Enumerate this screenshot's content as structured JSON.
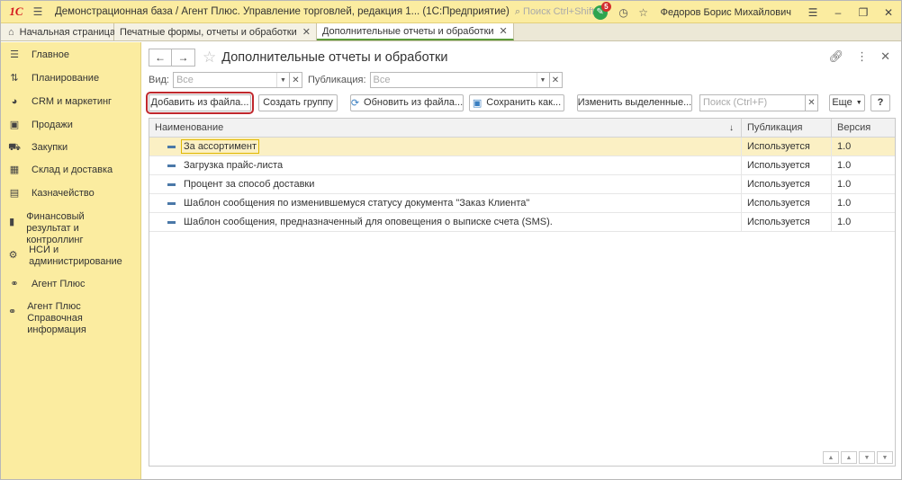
{
  "titlebar": {
    "logo": "1С",
    "title": "Демонстрационная база / Агент Плюс. Управление торговлей, редакция 1...  (1С:Предприятие)",
    "search_placeholder": "Поиск Ctrl+Shift+F",
    "notifications_count": "5",
    "user": "Федоров Борис Михайлович"
  },
  "tabs": {
    "home": "Начальная страница",
    "items": [
      {
        "label": "Печатные формы, отчеты и обработки"
      },
      {
        "label": "Дополнительные отчеты и обработки"
      }
    ]
  },
  "sidebar": {
    "items": [
      {
        "label": "Главное",
        "icon": "menu-icon"
      },
      {
        "label": "Планирование",
        "icon": "planning-icon"
      },
      {
        "label": "CRM и маркетинг",
        "icon": "crm-icon"
      },
      {
        "label": "Продажи",
        "icon": "sales-icon"
      },
      {
        "label": "Закупки",
        "icon": "cart-icon"
      },
      {
        "label": "Склад и доставка",
        "icon": "warehouse-icon"
      },
      {
        "label": "Казначейство",
        "icon": "treasury-icon"
      },
      {
        "label": "Финансовый результат и контроллинг",
        "icon": "finance-icon"
      },
      {
        "label": "НСИ и администрирование",
        "icon": "gear-icon"
      },
      {
        "label": "Агент Плюс",
        "icon": "link-icon"
      },
      {
        "label": "Агент Плюс Справочная информация",
        "icon": "link-icon"
      }
    ]
  },
  "form": {
    "title": "Дополнительные отчеты и обработки",
    "filter_kind_label": "Вид:",
    "filter_kind_value": "Все",
    "filter_pub_label": "Публикация:",
    "filter_pub_value": "Все",
    "toolbar": {
      "add_from_file": "Добавить из файла...",
      "create_group": "Создать группу",
      "update_from_file": "Обновить из файла...",
      "save_as": "Сохранить как...",
      "change_selected": "Изменить выделенные...",
      "search_placeholder": "Поиск (Ctrl+F)",
      "more": "Еще",
      "help": "?"
    },
    "table": {
      "columns": [
        "Наименование",
        "Публикация",
        "Версия"
      ],
      "rows": [
        {
          "name": "За ассортимент",
          "publication": "Используется",
          "version": "1.0"
        },
        {
          "name": "Загрузка прайс-листа",
          "publication": "Используется",
          "version": "1.0"
        },
        {
          "name": "Процент за способ доставки",
          "publication": "Используется",
          "version": "1.0"
        },
        {
          "name": "Шаблон сообщения по изменившемуся статусу документа \"Заказ Клиента\"",
          "publication": "Используется",
          "version": "1.0"
        },
        {
          "name": "Шаблон сообщения, предназначенный для оповещения о выписке счета (SMS).",
          "publication": "Используется",
          "version": "1.0"
        }
      ]
    }
  },
  "colors": {
    "sidebar_bg": "#fbeca0",
    "highlight_border": "#c0282d",
    "selected_row": "#fbf0c4"
  }
}
